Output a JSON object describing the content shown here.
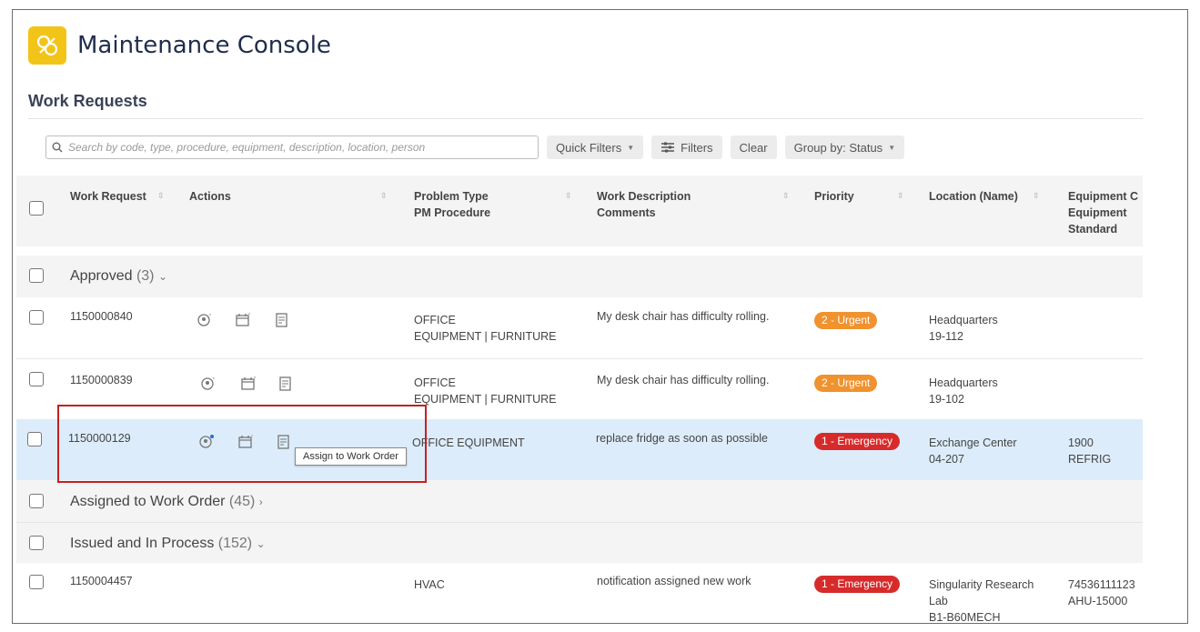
{
  "app": {
    "title": "Maintenance Console"
  },
  "section": {
    "title": "Work Requests"
  },
  "toolbar": {
    "search_placeholder": "Search by code, type, procedure, equipment, description, location, person",
    "quick_filters": "Quick Filters",
    "filters": "Filters",
    "clear": "Clear",
    "group_by": "Group by: Status"
  },
  "columns": {
    "work_request": "Work Request",
    "actions": "Actions",
    "problem_type": "Problem Type",
    "pm_procedure": "PM Procedure",
    "work_description": "Work Description",
    "comments": "Comments",
    "priority": "Priority",
    "location": "Location (Name)",
    "equipment_c": "Equipment C",
    "equipment": "Equipment",
    "standard": "Standard"
  },
  "groups": {
    "approved": {
      "label": "Approved",
      "count": "(3)"
    },
    "assigned": {
      "label": "Assigned to Work Order",
      "count": "(45)"
    },
    "issued": {
      "label": "Issued and In Process",
      "count": "(152)"
    }
  },
  "rows": [
    {
      "id": "1150000840",
      "problem": "OFFICE",
      "problem2": "EQUIPMENT | FURNITURE",
      "description": "My desk chair has difficulty rolling.",
      "priority": "2 - Urgent",
      "location": "Headquarters",
      "location2": "19-112",
      "equip": "",
      "equip2": ""
    },
    {
      "id": "1150000839",
      "problem": "OFFICE",
      "problem2": "EQUIPMENT | FURNITURE",
      "description": "My desk chair has difficulty rolling.",
      "priority": "2 - Urgent",
      "location": "Headquarters",
      "location2": "19-102",
      "equip": "",
      "equip2": ""
    },
    {
      "id": "1150000129",
      "problem": "OFFICE EQUIPMENT",
      "problem2": "",
      "description": "replace fridge as soon as possible",
      "priority": "1 - Emergency",
      "location": "Exchange Center",
      "location2": "04-207",
      "equip": "1900",
      "equip2": "REFRIG"
    },
    {
      "id": "1150004457",
      "problem": "HVAC",
      "problem2": "",
      "description": "notification assigned new work",
      "priority": "1 - Emergency",
      "location": "Singularity Research",
      "location2": "Lab",
      "location3": "B1-B60MECH",
      "equip": "74536111123",
      "equip2": "AHU-15000"
    }
  ],
  "tooltip": {
    "text": "Assign to Work Order"
  },
  "colors": {
    "accent": "#f2c418",
    "urgent": "#f0922e",
    "emergency": "#d72b2b",
    "selected_row": "#ddecfb",
    "highlight_box": "#c42020"
  }
}
